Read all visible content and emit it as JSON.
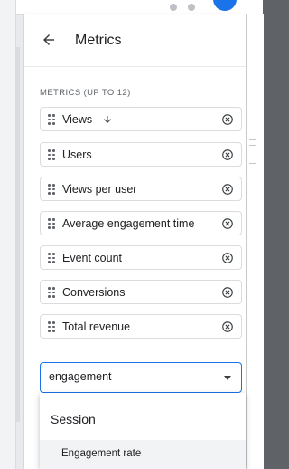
{
  "header": {
    "title": "Metrics"
  },
  "metrics_section": {
    "label": "METRICS (UP TO 12)",
    "items": [
      {
        "label": "Views"
      },
      {
        "label": "Users"
      },
      {
        "label": "Views per user"
      },
      {
        "label": "Average engagement time"
      },
      {
        "label": "Event count"
      },
      {
        "label": "Conversions"
      },
      {
        "label": "Total revenue"
      }
    ]
  },
  "search": {
    "value": "engagement"
  },
  "dropdown": {
    "group_label": "Session",
    "options": [
      {
        "label": "Engagement rate"
      }
    ]
  },
  "icons": {
    "back": "arrow-left-icon",
    "grip": "drag-handle-icon",
    "sort": "arrow-down-icon",
    "remove": "close-circle-icon",
    "dropdown": "caret-down-icon"
  },
  "colors": {
    "accent": "#1a73e8",
    "text": "#202124",
    "secondary_text": "#5f6368",
    "border": "#dadce0",
    "hover": "#f1f3f4"
  }
}
